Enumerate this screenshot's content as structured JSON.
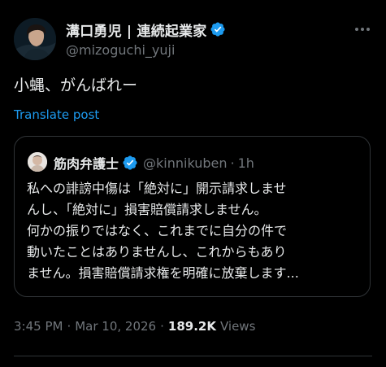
{
  "author": {
    "name": "溝口勇児 | 連続起業家",
    "handle": "@mizoguchi_yuji",
    "verified_color": "#1d9bf0"
  },
  "tweet": {
    "text": "小蝿、がんばれー",
    "translate_label": "Translate post"
  },
  "quote": {
    "name": "筋肉弁護士",
    "handle": "@kinnikuben",
    "separator": "·",
    "time": "1h",
    "lines": [
      "私への誹謗中傷は「絶対に」開示請求しませ",
      "んし、「絶対に」損害賠償請求しません。",
      "何かの振りではなく、これまでに自分の件で",
      "動いたことはありませんし、これからもあり",
      "ません。損害賠償請求権を明確に放棄します..."
    ]
  },
  "meta": {
    "time": "3:45 PM",
    "separator": "·",
    "date": "Mar 10, 2026",
    "views_count": "189.2K",
    "views_label": "Views"
  },
  "icons": {
    "verified": "verified-badge-icon",
    "more": "more-options-icon"
  },
  "colors": {
    "background": "#000000",
    "text": "#e7e9ea",
    "secondary": "#71767b",
    "link": "#1d9bf0",
    "border": "#2f3336"
  }
}
